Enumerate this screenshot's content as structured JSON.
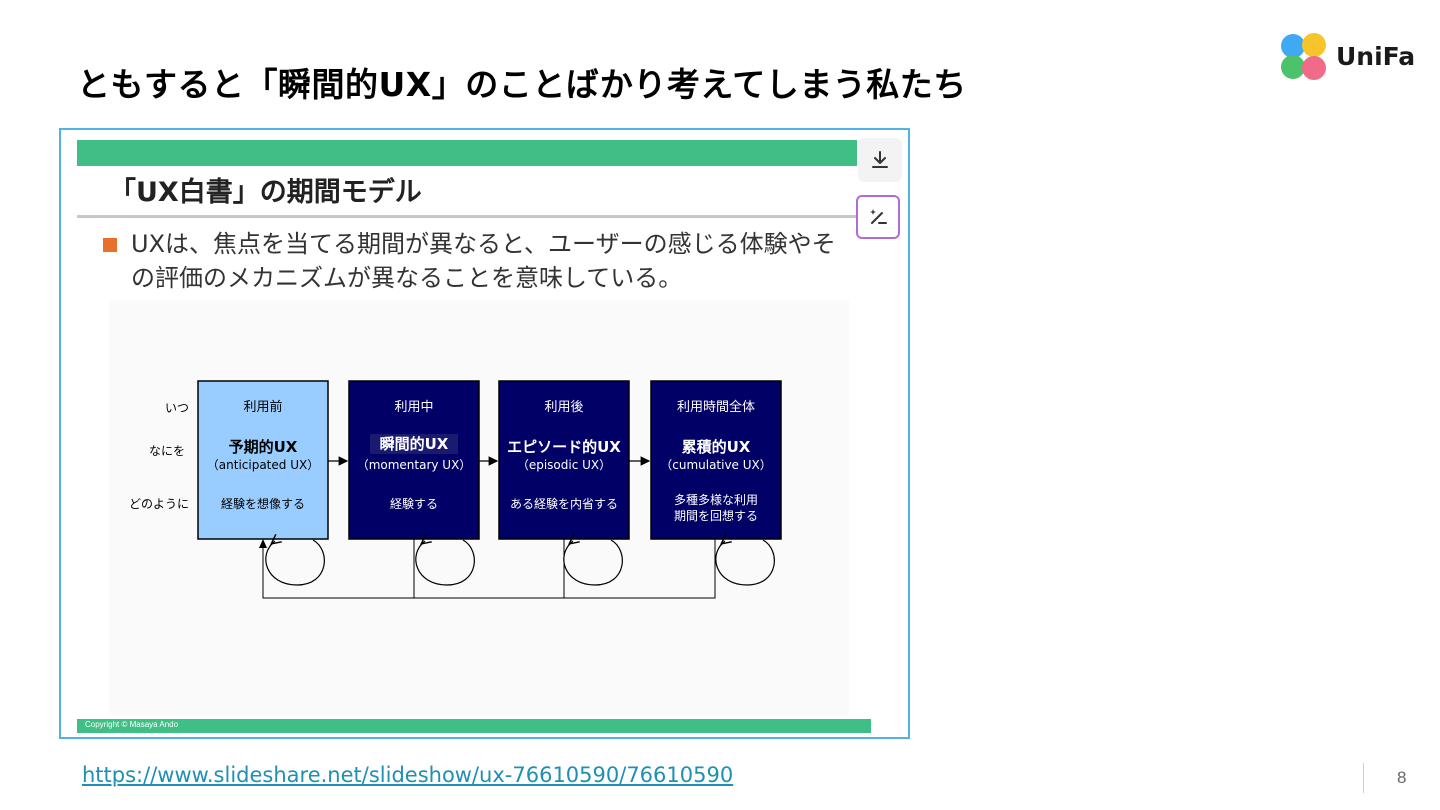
{
  "page": {
    "title": "ともすると「瞬間的UX」のことばかり考えてしまう私たち",
    "logo_text": "UniFa",
    "source_url": "https://www.slideshare.net/slideshow/ux-76610590/76610590",
    "page_number": "8"
  },
  "slide": {
    "heading": "「UX白書」の期間モデル",
    "bullet": "UXは、焦点を当てる期間が異なると、ユーザーの感じる体験やその評価のメカニズムが異なることを意味している。",
    "copyright": "Copyright ©   Masaya Ando"
  },
  "diagram": {
    "row_labels": [
      "いつ",
      "なにを",
      "どのように"
    ],
    "stages": [
      {
        "when": "利用前",
        "name": "予期的UX",
        "en": "（anticipated UX）",
        "how": [
          "経験を想像する"
        ]
      },
      {
        "when": "利用中",
        "name": "瞬間的UX",
        "en": "（momentary UX）",
        "how": [
          "経験する"
        ]
      },
      {
        "when": "利用後",
        "name": "エピソード的UX",
        "en": "（episodic UX）",
        "how": [
          "ある経験を内省する"
        ]
      },
      {
        "when": "利用時間全体",
        "name": "累積的UX",
        "en": "（cumulative UX）",
        "how": [
          "多種多様な利用",
          "期間を回想する"
        ]
      }
    ]
  },
  "colors": {
    "accent_green": "#3fbf85",
    "frame_border": "#4fb3e6",
    "bullet_orange": "#e8702a",
    "stage_light": "#99ccff",
    "stage_dark": "#000066",
    "link": "#1f8fb3"
  },
  "icons": {
    "download": "download-icon",
    "edit": "magic-edit-icon"
  }
}
